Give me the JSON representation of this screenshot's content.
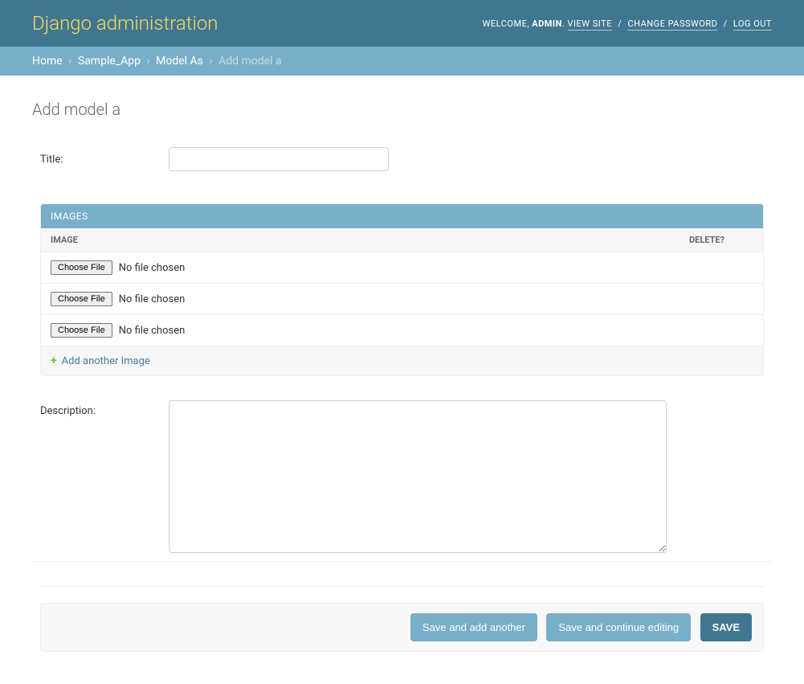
{
  "header": {
    "branding": "Django administration",
    "welcome": "WELCOME,",
    "user": "ADMIN",
    "view_site": "VIEW SITE",
    "change_password": "CHANGE PASSWORD",
    "log_out": "LOG OUT",
    "sep": "/"
  },
  "breadcrumbs": {
    "home": "Home",
    "app": "Sample_App",
    "model": "Model As",
    "current": "Add model a",
    "chev": "›"
  },
  "page": {
    "title": "Add model a"
  },
  "form": {
    "title_label": "Title:",
    "title_value": "",
    "description_label": "Description:",
    "description_value": ""
  },
  "inline": {
    "heading": "IMAGES",
    "col_image": "IMAGE",
    "col_delete": "DELETE?",
    "choose_label": "Choose File",
    "no_file": "No file chosen",
    "add_another": "Add another Image",
    "rows": [
      {},
      {},
      {}
    ]
  },
  "submit": {
    "save_add_another": "Save and add another",
    "save_continue": "Save and continue editing",
    "save": "SAVE"
  }
}
